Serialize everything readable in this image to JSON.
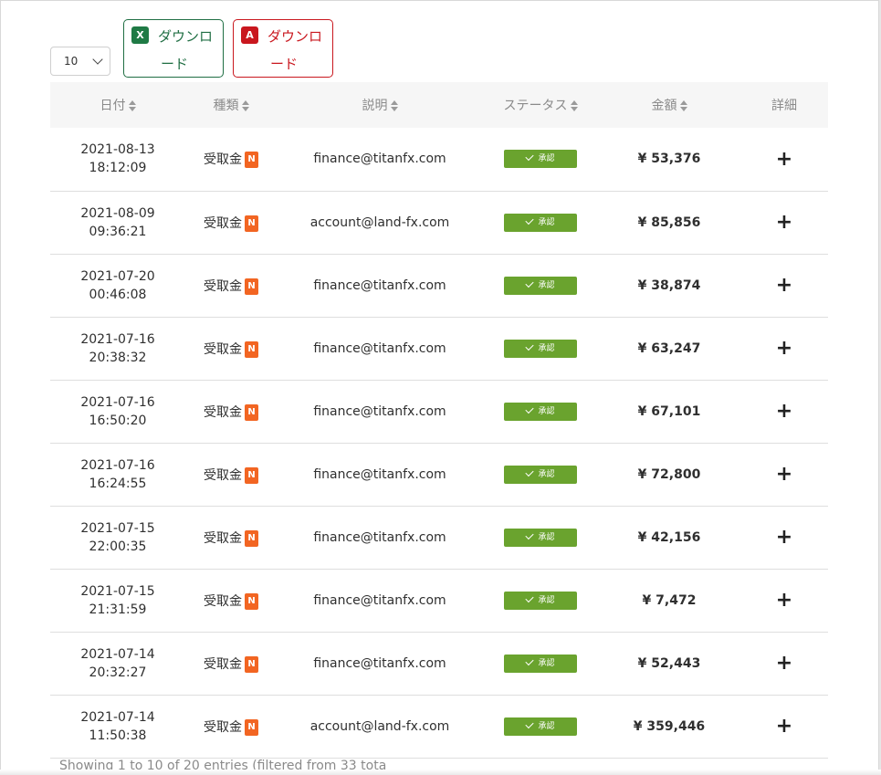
{
  "controls": {
    "page_length": "10",
    "excel_button_label": "ダウンロード",
    "pdf_button_label": "ダウンロード",
    "excel_icon_text": "X",
    "pdf_icon_text": "A"
  },
  "table": {
    "headers": [
      "日付",
      "種類",
      "説明",
      "ステータス",
      "金額",
      "詳細"
    ],
    "rows": [
      {
        "date": "2021-08-13",
        "time": "18:12:09",
        "type": "受取金",
        "badge": "N",
        "desc": "finance@titanfx.com",
        "status": "承認",
        "amount": "¥ 53,376",
        "detail": "+"
      },
      {
        "date": "2021-08-09",
        "time": "09:36:21",
        "type": "受取金",
        "badge": "N",
        "desc": "account@land-fx.com",
        "status": "承認",
        "amount": "¥ 85,856",
        "detail": "+"
      },
      {
        "date": "2021-07-20",
        "time": "00:46:08",
        "type": "受取金",
        "badge": "N",
        "desc": "finance@titanfx.com",
        "status": "承認",
        "amount": "¥ 38,874",
        "detail": "+"
      },
      {
        "date": "2021-07-16",
        "time": "20:38:32",
        "type": "受取金",
        "badge": "N",
        "desc": "finance@titanfx.com",
        "status": "承認",
        "amount": "¥ 63,247",
        "detail": "+"
      },
      {
        "date": "2021-07-16",
        "time": "16:50:20",
        "type": "受取金",
        "badge": "N",
        "desc": "finance@titanfx.com",
        "status": "承認",
        "amount": "¥ 67,101",
        "detail": "+"
      },
      {
        "date": "2021-07-16",
        "time": "16:24:55",
        "type": "受取金",
        "badge": "N",
        "desc": "finance@titanfx.com",
        "status": "承認",
        "amount": "¥ 72,800",
        "detail": "+"
      },
      {
        "date": "2021-07-15",
        "time": "22:00:35",
        "type": "受取金",
        "badge": "N",
        "desc": "finance@titanfx.com",
        "status": "承認",
        "amount": "¥ 42,156",
        "detail": "+"
      },
      {
        "date": "2021-07-15",
        "time": "21:31:59",
        "type": "受取金",
        "badge": "N",
        "desc": "finance@titanfx.com",
        "status": "承認",
        "amount": "¥ 7,472",
        "detail": "+"
      },
      {
        "date": "2021-07-14",
        "time": "20:32:27",
        "type": "受取金",
        "badge": "N",
        "desc": "finance@titanfx.com",
        "status": "承認",
        "amount": "¥ 52,443",
        "detail": "+"
      },
      {
        "date": "2021-07-14",
        "time": "11:50:38",
        "type": "受取金",
        "badge": "N",
        "desc": "account@land-fx.com",
        "status": "承認",
        "amount": "¥ 359,446",
        "detail": "+"
      }
    ]
  },
  "footer": {
    "info": "Showing 1 to 10 of 20 entries (filtered from 33 tota"
  },
  "colors": {
    "excel": "#1f6e43",
    "pdf": "#c9171e",
    "status_approved": "#6aa32e",
    "badge_new": "#f26522",
    "header_bg": "#f6f6f6"
  }
}
